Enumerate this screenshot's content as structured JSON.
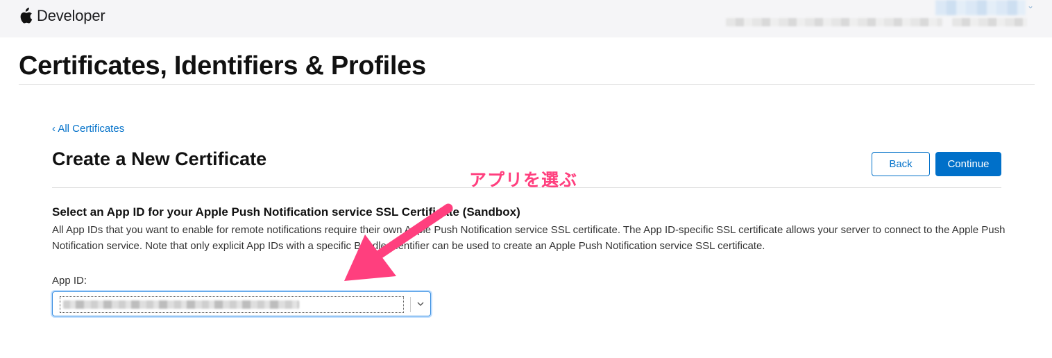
{
  "globalnav": {
    "brand": "Developer",
    "account_name": ""
  },
  "header": {
    "title": "Certificates, Identifiers & Profiles"
  },
  "breadcrumb": {
    "label": "‹ All Certificates"
  },
  "section": {
    "title": "Create a New Certificate",
    "back_label": "Back",
    "continue_label": "Continue"
  },
  "form": {
    "heading": "Select an App ID for your Apple Push Notification service SSL Certificate (Sandbox)",
    "description": "All App IDs that you want to enable for remote notifications require their own Apple Push Notification service SSL certificate. The App ID-specific SSL certificate allows your server to connect to the Apple Push Notification service. Note that only explicit App IDs with a specific Bundle Identifier can be used to create an Apple Push Notification service SSL certificate.",
    "app_id_label": "App ID:",
    "app_id_value": ""
  },
  "annotation": {
    "text": "アプリを選ぶ"
  },
  "colors": {
    "accent": "#0070c9",
    "annotation": "#ff3f7e",
    "nav_background": "#f5f5f7"
  },
  "icons": [
    "apple-logo-icon",
    "chevron-down-icon"
  ]
}
